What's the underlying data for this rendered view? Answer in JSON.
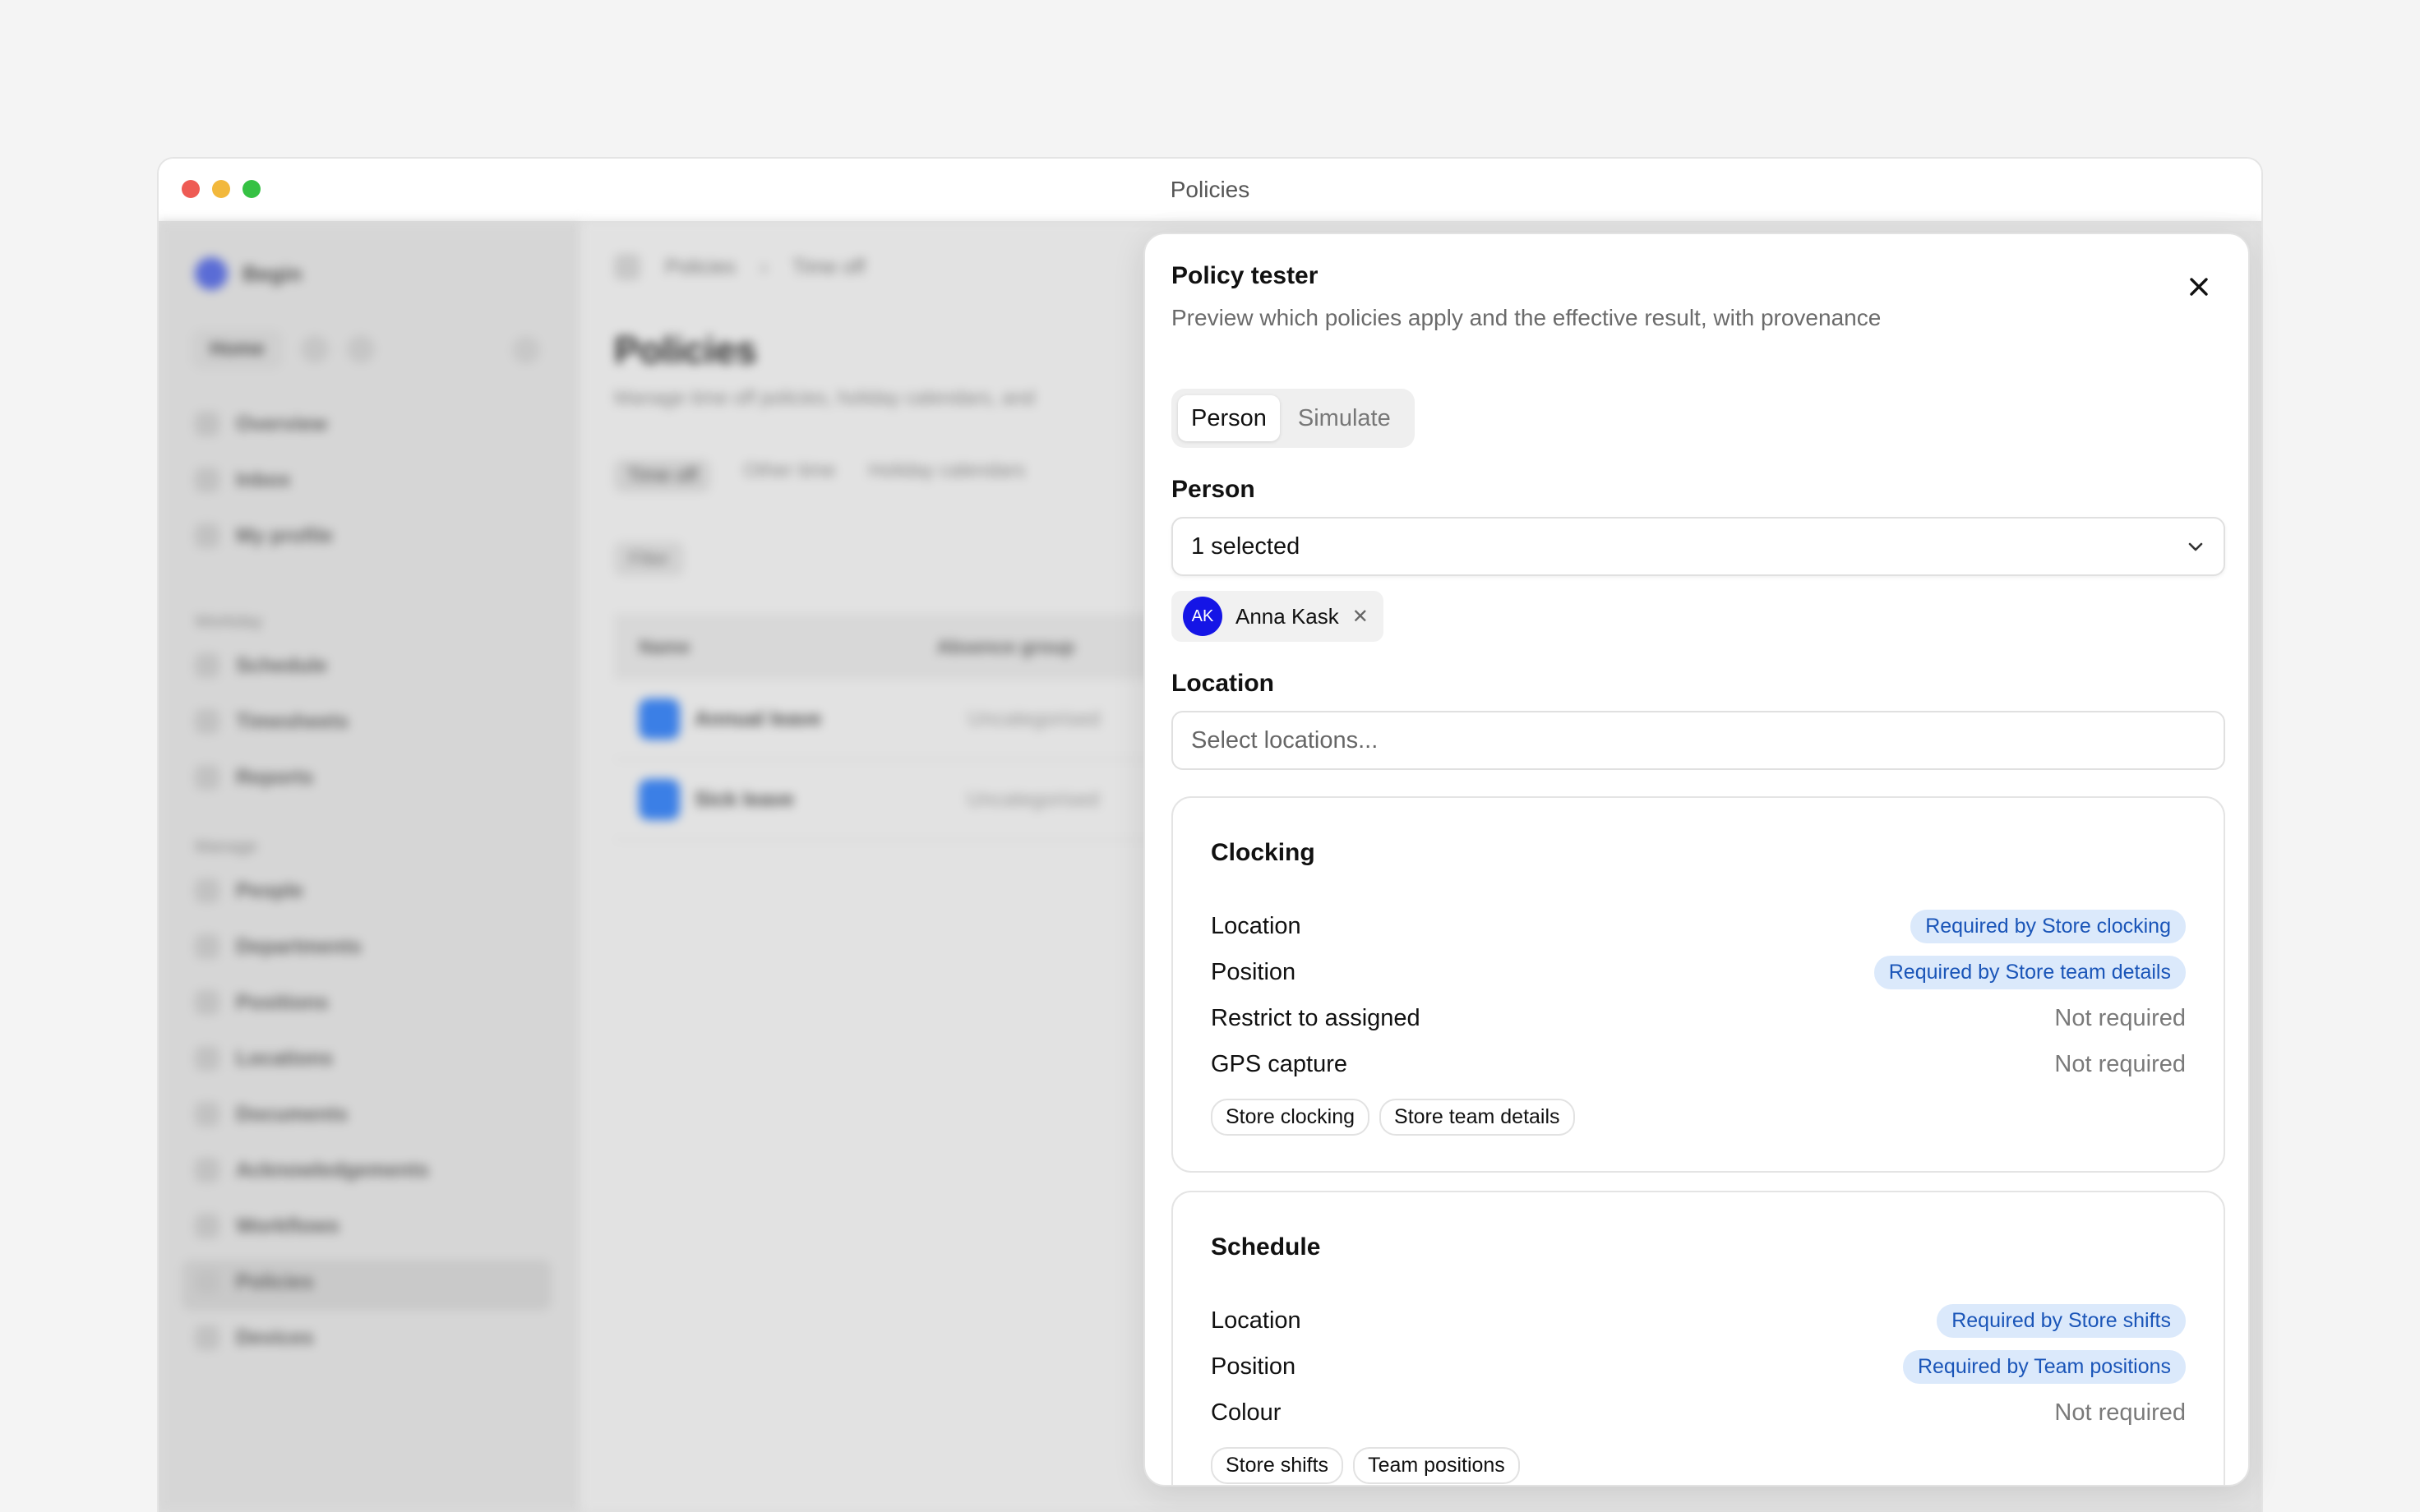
{
  "window": {
    "title": "Policies"
  },
  "sidebar": {
    "workspace": "Begin",
    "home_label": "Home",
    "items_top": [
      "Overview",
      "Inbox",
      "My profile"
    ],
    "section_workday": "Workday",
    "items_workday": [
      "Schedule",
      "Timesheets",
      "Reports"
    ],
    "section_manage": "Manage",
    "items_manage": [
      "People",
      "Departments",
      "Positions",
      "Locations",
      "Documents",
      "Acknowledgements",
      "Workflows",
      "Policies",
      "Devices"
    ]
  },
  "main": {
    "breadcrumb": [
      "Policies",
      "Time off"
    ],
    "title": "Policies",
    "subtitle": "Manage time off policies, holiday calendars, and",
    "tabs": [
      "Time off",
      "Other time",
      "Holiday calendars"
    ],
    "filter_label": "Filter",
    "columns": [
      "Name",
      "Absence group"
    ],
    "rows": [
      {
        "name": "Annual leave",
        "group": "Uncategorised"
      },
      {
        "name": "Sick leave",
        "group": "Uncategorised"
      }
    ]
  },
  "panel": {
    "title": "Policy tester",
    "description": "Preview which policies apply and the effective result, with provenance",
    "tabs": [
      "Person",
      "Simulate"
    ],
    "person_label": "Person",
    "person_value": "1 selected",
    "chip": {
      "initials": "AK",
      "name": "Anna Kask"
    },
    "location_label": "Location",
    "location_placeholder": "Select locations...",
    "sections": [
      {
        "title": "Clocking",
        "rows": [
          {
            "label": "Location",
            "value": "Required by Store clocking",
            "kind": "badge"
          },
          {
            "label": "Position",
            "value": "Required by Store team details",
            "kind": "badge"
          },
          {
            "label": "Restrict to assigned",
            "value": "Not required",
            "kind": "muted"
          },
          {
            "label": "GPS capture",
            "value": "Not required",
            "kind": "muted"
          }
        ],
        "tags": [
          "Store clocking",
          "Store team details"
        ]
      },
      {
        "title": "Schedule",
        "rows": [
          {
            "label": "Location",
            "value": "Required by Store shifts",
            "kind": "badge"
          },
          {
            "label": "Position",
            "value": "Required by Team positions",
            "kind": "badge"
          },
          {
            "label": "Colour",
            "value": "Not required",
            "kind": "muted"
          }
        ],
        "tags": [
          "Store shifts",
          "Team positions"
        ]
      }
    ]
  },
  "colors": {
    "badge_bg": "#dbe9fb",
    "badge_text": "#1a55b8",
    "avatar": "#1515e6"
  }
}
